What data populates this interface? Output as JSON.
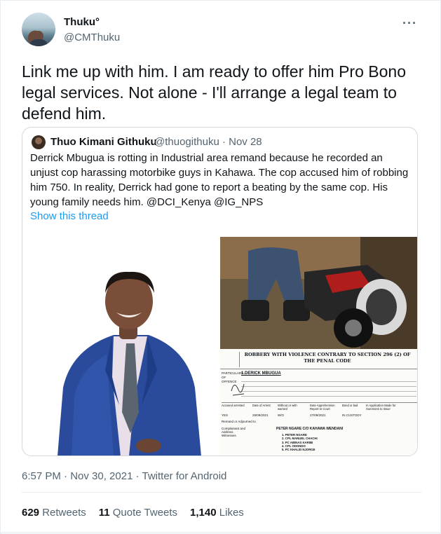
{
  "author": {
    "name": "Thuku°",
    "handle": "@CMThuku"
  },
  "more_icon": "more-horizontal-icon",
  "tweet_text": "Link me up with him. I am ready to offer him Pro Bono legal services. Not alone - I'll arrange a legal team to defend him.",
  "quoted": {
    "name": "Thuo Kimani Githuku",
    "handle_date": "@thuogithuku · Nov 28",
    "text": "Derrick Mbugua is rotting in Industrial area remand because he recorded an unjust cop harassing motorbike guys in Kahawa. The cop accused him of robbing him 750. In reality, Derrick had gone to report a beating by the same cop. His young family needs him. @DCI_Kenya @IG_NPS",
    "show_thread": "Show this thread",
    "document": {
      "heading": "ROBBERY WITH VIOLENCE CONTRARY TO SECTION 296 (2) OF THE PENAL CODE",
      "offence_label": "PARTICULARS OF OFFENCE",
      "offence_name": "1.DERICK MBUGUA",
      "row1": [
        "Accused arrested",
        "Date of Arrest",
        "Without or with warrant",
        "Date Apprehension Report to Court",
        "Bond or bail",
        "In Application Made for Summons to Issue"
      ],
      "row1_values": [
        "YES",
        "29/09/2021",
        "W/O",
        "27/09/2021",
        "IN CUSTODY"
      ],
      "complainant_label": "Complainant and Address",
      "complainant_value": "PETER NGARE C/O KAHAWA WENDANI",
      "witnesses_label": "Witnesses",
      "witnesses": [
        "1.   PETER NGARE",
        "2.   CPL MANUEL CHACHI",
        "3.   PC ABINAS KARIBI",
        "4.   CPL ODONDO",
        "5.   PC KHALID NJORGE"
      ],
      "remanded_label": "Remand or Adjourned to"
    }
  },
  "meta": "6:57 PM · Nov 30, 2021 · Twitter for Android",
  "stats": {
    "retweets_count": "629",
    "retweets_label": "Retweets",
    "quotes_count": "11",
    "quotes_label": "Quote Tweets",
    "likes_count": "1,140",
    "likes_label": "Likes"
  }
}
